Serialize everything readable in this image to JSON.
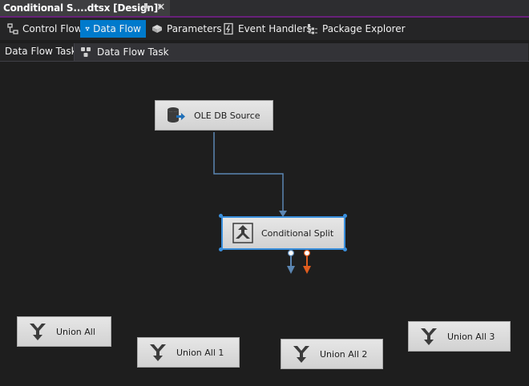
{
  "document_tab": {
    "title": "Conditional S....dtsx [Design]*",
    "pin_icon": "pin-icon",
    "close_icon": "close-icon"
  },
  "designer_tabs": [
    {
      "label": "Control Flow",
      "icon": "control-flow-icon",
      "active": false
    },
    {
      "label": "Data Flow",
      "icon": "data-flow-icon",
      "active": true
    },
    {
      "label": "Parameters",
      "icon": "parameters-icon",
      "active": false
    },
    {
      "label": "Event Handlers",
      "icon": "event-handlers-icon",
      "active": false
    },
    {
      "label": "Package Explorer",
      "icon": "package-explorer-icon",
      "active": false
    }
  ],
  "task_selector": {
    "label": "Data Flow Task:",
    "value": "Data Flow Task"
  },
  "components": {
    "ole_db_source": {
      "label": "OLE DB Source",
      "icon": "ole-db-source-icon"
    },
    "conditional_split": {
      "label": "Conditional Split",
      "icon": "conditional-split-icon",
      "selected": true
    },
    "union_all": {
      "label": "Union All",
      "icon": "union-all-icon"
    },
    "union_all_1": {
      "label": "Union All 1",
      "icon": "union-all-icon"
    },
    "union_all_2": {
      "label": "Union All 2",
      "icon": "union-all-icon"
    },
    "union_all_3": {
      "label": "Union All 3",
      "icon": "union-all-icon"
    }
  },
  "colors": {
    "accent": "#007acc",
    "tab_underline": "#68217a",
    "selection": "#3a8fdc",
    "path_normal": "#5b86b3",
    "path_error": "#e05c1e",
    "canvas": "#1e1e1e"
  }
}
